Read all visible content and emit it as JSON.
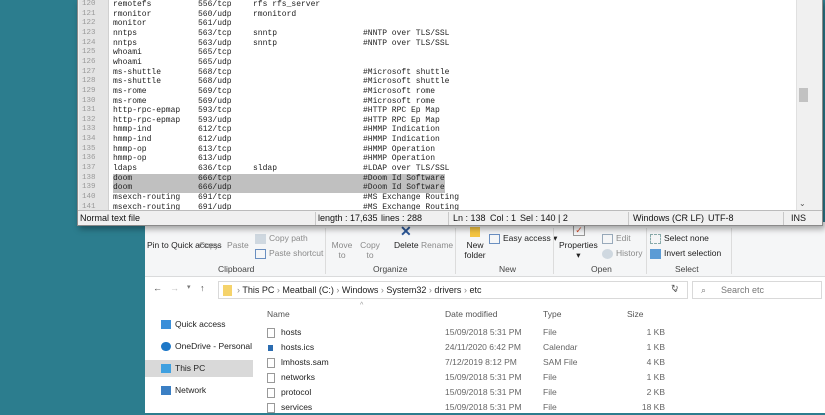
{
  "editor": {
    "lines": [
      {
        "n": "120",
        "name": "remotefs",
        "port": "556/tcp",
        "alias": "rfs rfs_server",
        "comment": ""
      },
      {
        "n": "121",
        "name": "rmonitor",
        "port": "560/udp",
        "alias": "rmonitord",
        "comment": ""
      },
      {
        "n": "122",
        "name": "monitor",
        "port": "561/udp",
        "alias": "",
        "comment": ""
      },
      {
        "n": "123",
        "name": "nntps",
        "port": "563/tcp",
        "alias": "snntp",
        "comment": "#NNTP over TLS/SSL"
      },
      {
        "n": "124",
        "name": "nntps",
        "port": "563/udp",
        "alias": "snntp",
        "comment": "#NNTP over TLS/SSL"
      },
      {
        "n": "125",
        "name": "whoami",
        "port": "565/tcp",
        "alias": "",
        "comment": ""
      },
      {
        "n": "126",
        "name": "whoami",
        "port": "565/udp",
        "alias": "",
        "comment": ""
      },
      {
        "n": "127",
        "name": "ms-shuttle",
        "port": "568/tcp",
        "alias": "",
        "comment": "#Microsoft shuttle"
      },
      {
        "n": "128",
        "name": "ms-shuttle",
        "port": "568/udp",
        "alias": "",
        "comment": "#Microsoft shuttle"
      },
      {
        "n": "129",
        "name": "ms-rome",
        "port": "569/tcp",
        "alias": "",
        "comment": "#Microsoft rome"
      },
      {
        "n": "130",
        "name": "ms-rome",
        "port": "569/udp",
        "alias": "",
        "comment": "#Microsoft rome"
      },
      {
        "n": "131",
        "name": "http-rpc-epmap",
        "port": "593/tcp",
        "alias": "",
        "comment": "#HTTP RPC Ep Map"
      },
      {
        "n": "132",
        "name": "http-rpc-epmap",
        "port": "593/udp",
        "alias": "",
        "comment": "#HTTP RPC Ep Map"
      },
      {
        "n": "133",
        "name": "hmmp-ind",
        "port": "612/tcp",
        "alias": "",
        "comment": "#HMMP Indication"
      },
      {
        "n": "134",
        "name": "hmmp-ind",
        "port": "612/udp",
        "alias": "",
        "comment": "#HMMP Indication"
      },
      {
        "n": "135",
        "name": "hmmp-op",
        "port": "613/tcp",
        "alias": "",
        "comment": "#HMMP Operation"
      },
      {
        "n": "136",
        "name": "hmmp-op",
        "port": "613/udp",
        "alias": "",
        "comment": "#HMMP Operation"
      },
      {
        "n": "137",
        "name": "ldaps",
        "port": "636/tcp",
        "alias": "sldap",
        "comment": "#LDAP over TLS/SSL"
      },
      {
        "n": "138",
        "name": "doom",
        "port": "666/tcp",
        "alias": "",
        "comment": "#Doom Id Software"
      },
      {
        "n": "139",
        "name": "doom",
        "port": "666/udp",
        "alias": "",
        "comment": "#Doom Id Software"
      },
      {
        "n": "140",
        "name": "msexch-routing",
        "port": "691/tcp",
        "alias": "",
        "comment": "#MS Exchange Routing"
      },
      {
        "n": "141",
        "name": "msexch-routing",
        "port": "691/udp",
        "alias": "",
        "comment": "#MS Exchange Routing"
      }
    ],
    "current_line": "138",
    "selected_lines": [
      "138",
      "139"
    ]
  },
  "status": {
    "filetype": "Normal text file",
    "length": "length : 17,635",
    "lines": "lines : 288",
    "ln": "Ln : 138",
    "col": "Col : 1",
    "sel": "Sel : 140 | 2",
    "eol": "Windows (CR LF)",
    "encoding": "UTF-8",
    "mode": "INS"
  },
  "ribbon": {
    "pin": "Pin to Quick access",
    "copy": "Copy",
    "paste": "Paste",
    "copy_path": "Copy path",
    "paste_shortcut": "Paste shortcut",
    "clipboard": "Clipboard",
    "move_to": "Move to",
    "copy_to": "Copy to",
    "delete": "Delete",
    "rename": "Rename",
    "organize": "Organize",
    "new_folder": "New folder",
    "easy_access": "Easy access",
    "new": "New",
    "properties": "Properties",
    "edit": "Edit",
    "history": "History",
    "open": "Open",
    "select_none": "Select none",
    "invert_selection": "Invert selection",
    "select": "Select"
  },
  "address": {
    "crumbs": [
      "This PC",
      "Meatball (C:)",
      "Windows",
      "System32",
      "drivers",
      "etc"
    ],
    "search_placeholder": "Search etc"
  },
  "nav": [
    {
      "label": "Quick access"
    },
    {
      "label": "OneDrive - Personal"
    },
    {
      "label": "This PC",
      "selected": true
    },
    {
      "label": "Network"
    }
  ],
  "files": {
    "columns": [
      "Name",
      "Date modified",
      "Type",
      "Size"
    ],
    "rows": [
      {
        "name": "hosts",
        "date": "15/09/2018 5:31 PM",
        "type": "File",
        "size": "1 KB"
      },
      {
        "name": "hosts.ics",
        "date": "24/11/2020 6:42 PM",
        "type": "Calendar",
        "size": "1 KB"
      },
      {
        "name": "lmhosts.sam",
        "date": "7/12/2019 8:12 PM",
        "type": "SAM File",
        "size": "4 KB"
      },
      {
        "name": "networks",
        "date": "15/09/2018 5:31 PM",
        "type": "File",
        "size": "1 KB"
      },
      {
        "name": "protocol",
        "date": "15/09/2018 5:31 PM",
        "type": "File",
        "size": "2 KB"
      },
      {
        "name": "services",
        "date": "15/09/2018 5:31 PM",
        "type": "File",
        "size": "18 KB"
      }
    ]
  }
}
